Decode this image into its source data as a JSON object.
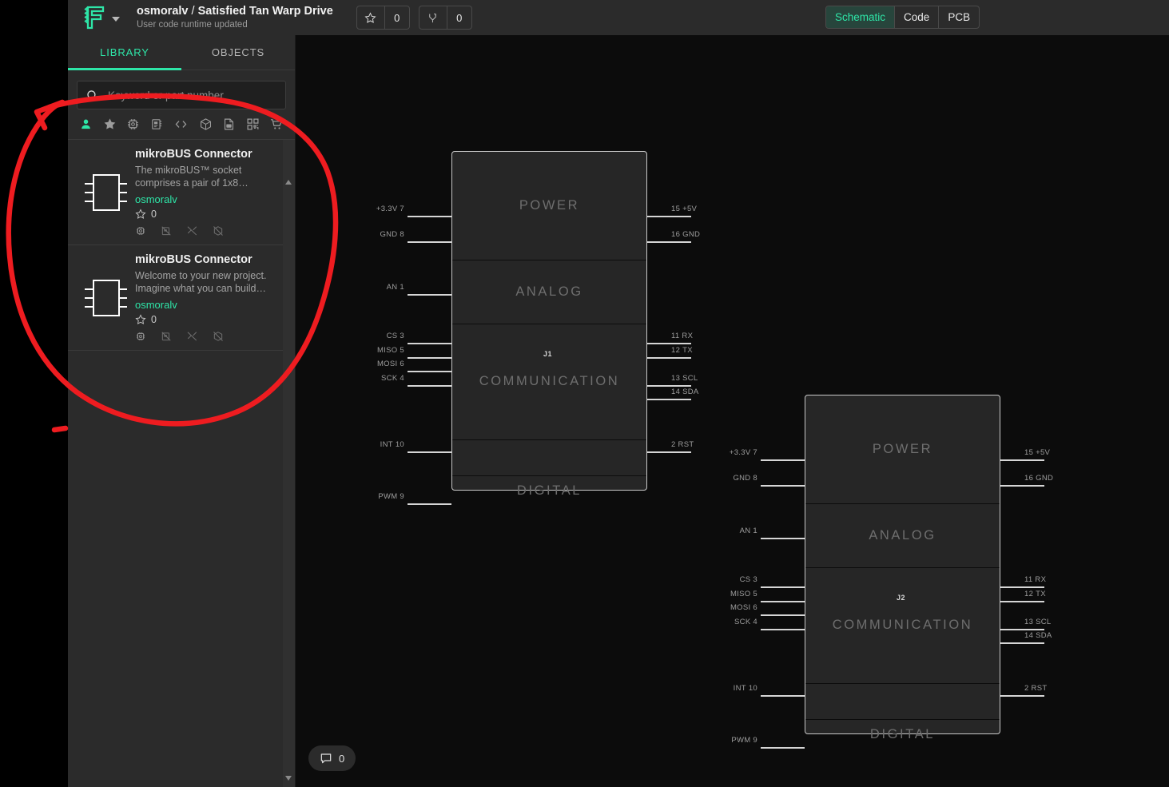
{
  "header": {
    "logo_icon": "flux-logo-icon",
    "dropdown_icon": "chevron-down-icon",
    "owner": "osmoralv",
    "separator": " / ",
    "project_name": "Satisfied Tan Warp Drive",
    "subtitle": "User code runtime updated",
    "star_icon": "star-icon",
    "star_count": "0",
    "fork_icon": "fork-icon",
    "fork_count": "0",
    "view_tabs": [
      {
        "label": "Schematic",
        "active": true
      },
      {
        "label": "Code",
        "active": false
      },
      {
        "label": "PCB",
        "active": false
      }
    ]
  },
  "panel": {
    "tabs": [
      {
        "label": "LIBRARY",
        "active": true
      },
      {
        "label": "OBJECTS",
        "active": false
      }
    ],
    "search": {
      "icon": "search-icon",
      "placeholder": "Keyword or part number",
      "value": ""
    },
    "filters": [
      {
        "name": "person-icon",
        "active": true
      },
      {
        "name": "star-icon",
        "active": false
      },
      {
        "name": "chip-icon",
        "active": false
      },
      {
        "name": "ic-board-icon",
        "active": false
      },
      {
        "name": "code-brackets-icon",
        "active": false
      },
      {
        "name": "cube-3d-icon",
        "active": false
      },
      {
        "name": "pdf-document-icon",
        "active": false
      },
      {
        "name": "qr-code-icon",
        "active": false
      },
      {
        "name": "shopping-cart-icon",
        "active": false
      }
    ],
    "results": [
      {
        "symbol_icon": "ic-symbol-icon",
        "title": "mikroBUS Connector",
        "description": "The mikroBUS™ socket comprises a pair of 1x8…",
        "author": "osmoralv",
        "star_icon": "star-outline-icon",
        "star_count": "0",
        "badges": [
          "chip-icon",
          "footprint-off-icon",
          "schematic-off-icon",
          "model-3d-off-icon"
        ]
      },
      {
        "symbol_icon": "ic-symbol-icon",
        "title": "mikroBUS Connector",
        "description": "Welcome to your new project. Imagine what you can build…",
        "author": "osmoralv",
        "star_icon": "star-outline-icon",
        "star_count": "0",
        "badges": [
          "chip-icon",
          "footprint-off-icon",
          "schematic-off-icon",
          "model-3d-off-icon"
        ]
      }
    ],
    "scroll_up_icon": "scroll-up-arrow-icon",
    "scroll_down_icon": "scroll-down-arrow-icon"
  },
  "canvas": {
    "comment_icon": "comment-icon",
    "comment_count": "0",
    "parts": [
      {
        "ref": "J1",
        "sections": [
          "POWER",
          "ANALOG",
          "COMMUNICATION",
          "",
          "DIGITAL"
        ],
        "pins_left": [
          {
            "label": "+3.3V",
            "number": "7"
          },
          {
            "label": "GND",
            "number": "8"
          },
          {
            "label": "AN",
            "number": "1"
          },
          {
            "label": "CS",
            "number": "3"
          },
          {
            "label": "MISO",
            "number": "5"
          },
          {
            "label": "MOSI",
            "number": "6"
          },
          {
            "label": "SCK",
            "number": "4"
          },
          {
            "label": "INT",
            "number": "10"
          },
          {
            "label": "PWM",
            "number": "9"
          }
        ],
        "pins_right": [
          {
            "number": "15",
            "label": "+5V"
          },
          {
            "number": "16",
            "label": "GND"
          },
          {
            "number": "11",
            "label": "RX"
          },
          {
            "number": "12",
            "label": "TX"
          },
          {
            "number": "13",
            "label": "SCL"
          },
          {
            "number": "14",
            "label": "SDA"
          },
          {
            "number": "2",
            "label": "RST"
          }
        ]
      },
      {
        "ref": "J2",
        "sections": [
          "POWER",
          "ANALOG",
          "COMMUNICATION",
          "",
          "DIGITAL"
        ],
        "pins_left": [
          {
            "label": "+3.3V",
            "number": "7"
          },
          {
            "label": "GND",
            "number": "8"
          },
          {
            "label": "AN",
            "number": "1"
          },
          {
            "label": "CS",
            "number": "3"
          },
          {
            "label": "MISO",
            "number": "5"
          },
          {
            "label": "MOSI",
            "number": "6"
          },
          {
            "label": "SCK",
            "number": "4"
          },
          {
            "label": "INT",
            "number": "10"
          },
          {
            "label": "PWM",
            "number": "9"
          }
        ],
        "pins_right": [
          {
            "number": "15",
            "label": "+5V"
          },
          {
            "number": "16",
            "label": "GND"
          },
          {
            "number": "11",
            "label": "RX"
          },
          {
            "number": "12",
            "label": "TX"
          },
          {
            "number": "13",
            "label": "SCL"
          },
          {
            "number": "14",
            "label": "SDA"
          },
          {
            "number": "2",
            "label": "RST"
          }
        ]
      }
    ]
  },
  "annotation": {
    "name": "red-hand-drawn-circle",
    "color": "#ee1c20",
    "describes": "hand-drawn red loop with arrowhead enclosing the library search results"
  },
  "colors": {
    "accent_green": "#2ee6a8",
    "panel_bg": "#2b2b2b",
    "canvas_bg": "#0c0c0c",
    "annotation_red": "#ee1c20"
  }
}
